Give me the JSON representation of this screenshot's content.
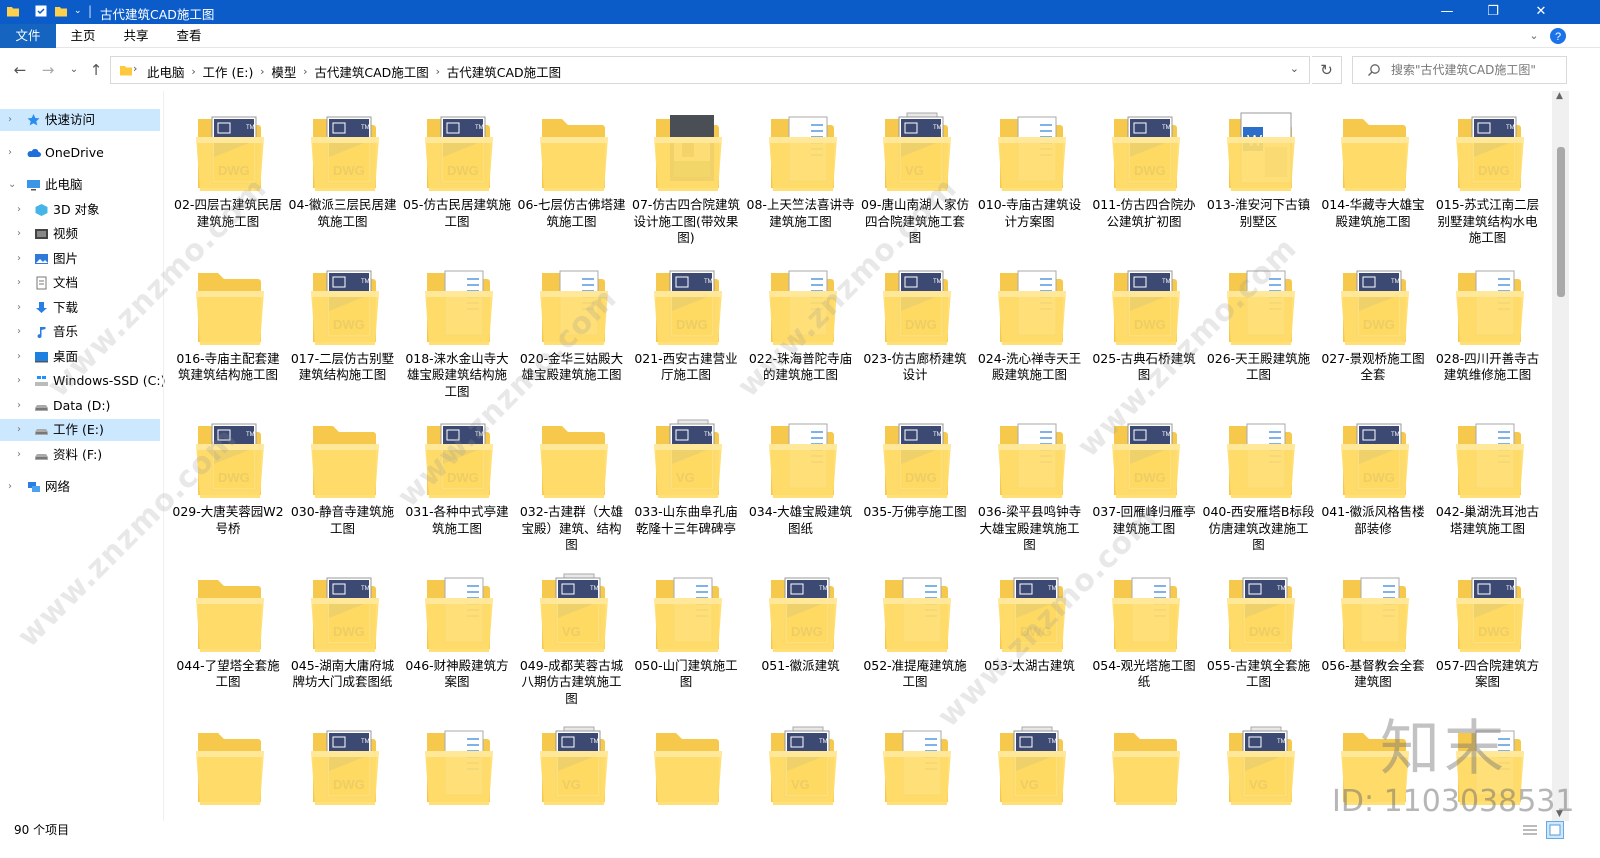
{
  "window": {
    "title": "古代建筑CAD施工图",
    "minimize": "—",
    "maximize": "❐",
    "close": "✕"
  },
  "ribbon": {
    "tabs": [
      "文件",
      "主页",
      "共享",
      "查看"
    ]
  },
  "address": {
    "breadcrumbs": [
      "此电脑",
      "工作 (E:)",
      "模型",
      "古代建筑CAD施工图",
      "古代建筑CAD施工图"
    ],
    "search_placeholder": "搜索\"古代建筑CAD施工图\""
  },
  "navigation": {
    "quick_access": "快速访问",
    "onedrive": "OneDrive",
    "this_pc": "此电脑",
    "items": [
      "3D 对象",
      "视频",
      "图片",
      "文档",
      "下载",
      "音乐",
      "桌面",
      "Windows-SSD (C:)",
      "Data (D:)",
      "工作 (E:)",
      "资料 (F:)"
    ],
    "network": "网络",
    "selected": "工作 (E:)"
  },
  "files": [
    {
      "name": "02-四层古建筑民居建筑施工图",
      "icon": "dwg"
    },
    {
      "name": "04-徽派三层民居建筑施工图",
      "icon": "dwg"
    },
    {
      "name": "05-仿古民居建筑施工图",
      "icon": "dwg"
    },
    {
      "name": "06-七层仿古佛塔建筑施工图",
      "icon": "plain"
    },
    {
      "name": "07-仿古四合院建筑设计施工图(带效果图)",
      "icon": "photo"
    },
    {
      "name": "08-上天竺法喜讲寺建筑施工图",
      "icon": "doc"
    },
    {
      "name": "09-唐山南湖人家仿四合院建筑施工套图",
      "icon": "dwg-multi"
    },
    {
      "name": "010-寺庙古建筑设计方案图",
      "icon": "doc"
    },
    {
      "name": "011-仿古四合院办公建筑扩初图",
      "icon": "dwg"
    },
    {
      "name": "013-淮安河下古镇别墅区",
      "icon": "word"
    },
    {
      "name": "014-华藏寺大雄宝殿建筑施工图",
      "icon": "plain"
    },
    {
      "name": "015-苏式江南二层别墅建筑结构水电施工图",
      "icon": "dwg"
    },
    {
      "name": "016-寺庙主配套建筑建筑结构施工图",
      "icon": "plain"
    },
    {
      "name": "017-二层仿古别墅建筑结构施工图",
      "icon": "dwg"
    },
    {
      "name": "018-涞水金山寺大雄宝殿建筑结构施工图",
      "icon": "doc"
    },
    {
      "name": "020-金华三姑殿大雄宝殿建筑施工图",
      "icon": "doc"
    },
    {
      "name": "021-西安古建营业厅施工图",
      "icon": "dwg"
    },
    {
      "name": "022-珠海普陀寺庙的建筑施工图",
      "icon": "doc"
    },
    {
      "name": "023-仿古廊桥建筑设计",
      "icon": "dwg"
    },
    {
      "name": "024-洗心禅寺天王殿建筑施工图",
      "icon": "doc"
    },
    {
      "name": "025-古典石桥建筑图",
      "icon": "dwg"
    },
    {
      "name": "026-天王殿建筑施工图",
      "icon": "doc"
    },
    {
      "name": "027-景观桥施工图全套",
      "icon": "dwg"
    },
    {
      "name": "028-四川开善寺古建筑维修施工图",
      "icon": "doc"
    },
    {
      "name": "029-大唐芙蓉园W2号桥",
      "icon": "dwg"
    },
    {
      "name": "030-静音寺建筑施工图",
      "icon": "plain"
    },
    {
      "name": "031-各种中式亭建筑施工图",
      "icon": "dwg"
    },
    {
      "name": "032-古建群（大雄宝殿）建筑、结构图",
      "icon": "plain"
    },
    {
      "name": "033-山东曲阜孔庙乾隆十三年碑碑亭",
      "icon": "dwg-multi"
    },
    {
      "name": "034-大雄宝殿建筑图纸",
      "icon": "doc"
    },
    {
      "name": "035-万佛亭施工图",
      "icon": "dwg"
    },
    {
      "name": "036-梁平县鸣钟寺大雄宝殿建筑施工图",
      "icon": "doc"
    },
    {
      "name": "037-回雁峰归雁亭建筑施工图",
      "icon": "dwg"
    },
    {
      "name": "040-西安雁塔B标段仿唐建筑改建施工图",
      "icon": "doc"
    },
    {
      "name": "041-徽派风格售楼部装修",
      "icon": "dwg"
    },
    {
      "name": "042-巢湖洗耳池古塔建筑施工图",
      "icon": "doc"
    },
    {
      "name": "044-了望塔全套施工图",
      "icon": "plain"
    },
    {
      "name": "045-湖南大庸府城牌坊大门成套图纸",
      "icon": "dwg"
    },
    {
      "name": "046-财神殿建筑方案图",
      "icon": "doc"
    },
    {
      "name": "049-成都芙蓉古城八期仿古建筑施工图",
      "icon": "dwg-multi"
    },
    {
      "name": "050-山门建筑施工图",
      "icon": "doc"
    },
    {
      "name": "051-徽派建筑",
      "icon": "dwg"
    },
    {
      "name": "052-准提庵建筑施工图",
      "icon": "doc"
    },
    {
      "name": "053-太湖古建筑",
      "icon": "dwg"
    },
    {
      "name": "054-观光塔施工图纸",
      "icon": "doc"
    },
    {
      "name": "055-古建筑全套施工图",
      "icon": "dwg"
    },
    {
      "name": "056-基督教会全套建筑图",
      "icon": "doc"
    },
    {
      "name": "057-四合院建筑方案图",
      "icon": "dwg"
    },
    {
      "name": "",
      "icon": "plain"
    },
    {
      "name": "",
      "icon": "dwg"
    },
    {
      "name": "",
      "icon": "doc"
    },
    {
      "name": "",
      "icon": "dwg-multi"
    },
    {
      "name": "",
      "icon": "plain"
    },
    {
      "name": "",
      "icon": "dwg-multi"
    },
    {
      "name": "",
      "icon": "doc"
    },
    {
      "name": "",
      "icon": "dwg-multi"
    },
    {
      "name": "",
      "icon": "plain"
    },
    {
      "name": "",
      "icon": "dwg-multi"
    },
    {
      "name": "",
      "icon": "plain"
    },
    {
      "name": "",
      "icon": "doc"
    }
  ],
  "status": {
    "count": "90 个项目"
  },
  "watermark": {
    "text": "www.znzmo.com",
    "brand": "知末",
    "id": "ID: 1103038531"
  }
}
